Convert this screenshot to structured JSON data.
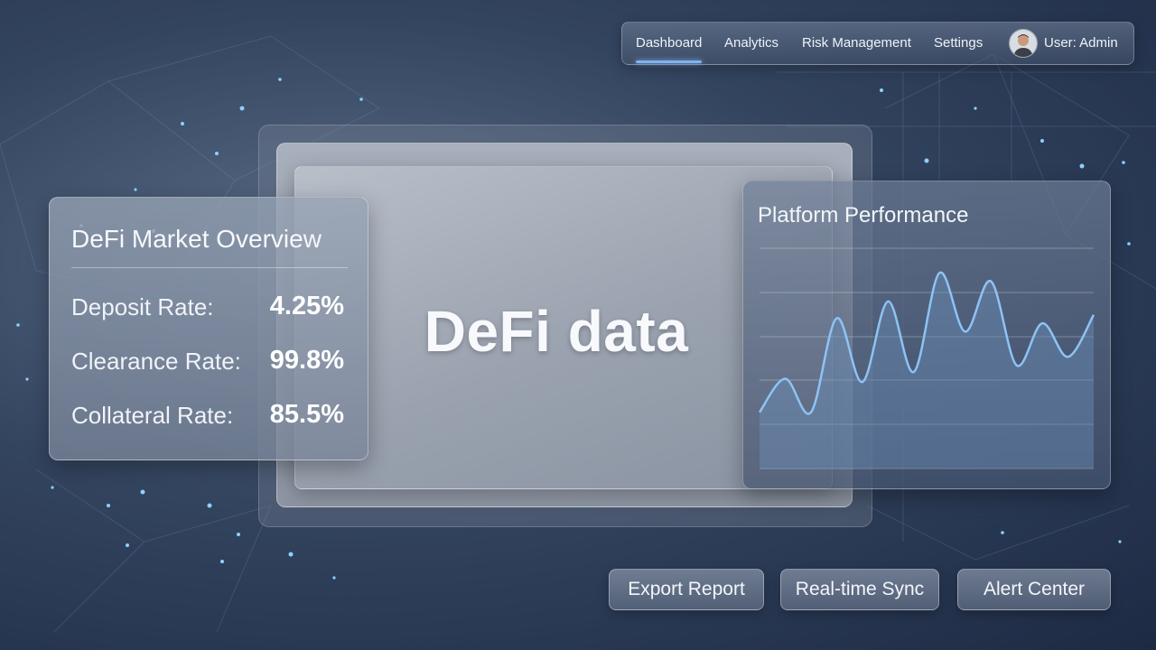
{
  "nav": {
    "items": [
      {
        "label": "Dashboard",
        "active": true
      },
      {
        "label": "Analytics",
        "active": false
      },
      {
        "label": "Risk Management",
        "active": false
      },
      {
        "label": "Settings",
        "active": false
      }
    ],
    "user_label": "User: Admin",
    "avatar_icon": "user-avatar"
  },
  "center": {
    "title": "DeFi data"
  },
  "overview": {
    "title": "DeFi Market Overview",
    "rows": [
      {
        "label": "Deposit Rate:",
        "value": "4.25%"
      },
      {
        "label": "Clearance Rate:",
        "value": "99.8%"
      },
      {
        "label": "Collateral Rate:",
        "value": "85.5%"
      }
    ]
  },
  "performance": {
    "title": "Platform Performance",
    "chart_data": {
      "type": "area",
      "title": "Platform Performance",
      "x": [
        0,
        1,
        2,
        3,
        4,
        5,
        6,
        7,
        8,
        9,
        10,
        11,
        12,
        13
      ],
      "values": [
        12,
        32,
        12,
        68,
        30,
        78,
        36,
        95,
        60,
        90,
        40,
        65,
        45,
        70
      ],
      "ylim": [
        0,
        100
      ],
      "grid": true,
      "colors": {
        "line": "#8ec3f5",
        "fill": "#6b8fb8"
      }
    }
  },
  "actions": [
    {
      "label": "Export Report"
    },
    {
      "label": "Real-time Sync"
    },
    {
      "label": "Alert Center"
    }
  ],
  "colors": {
    "accent": "#7fb3ee",
    "background": "#2b3a55"
  }
}
